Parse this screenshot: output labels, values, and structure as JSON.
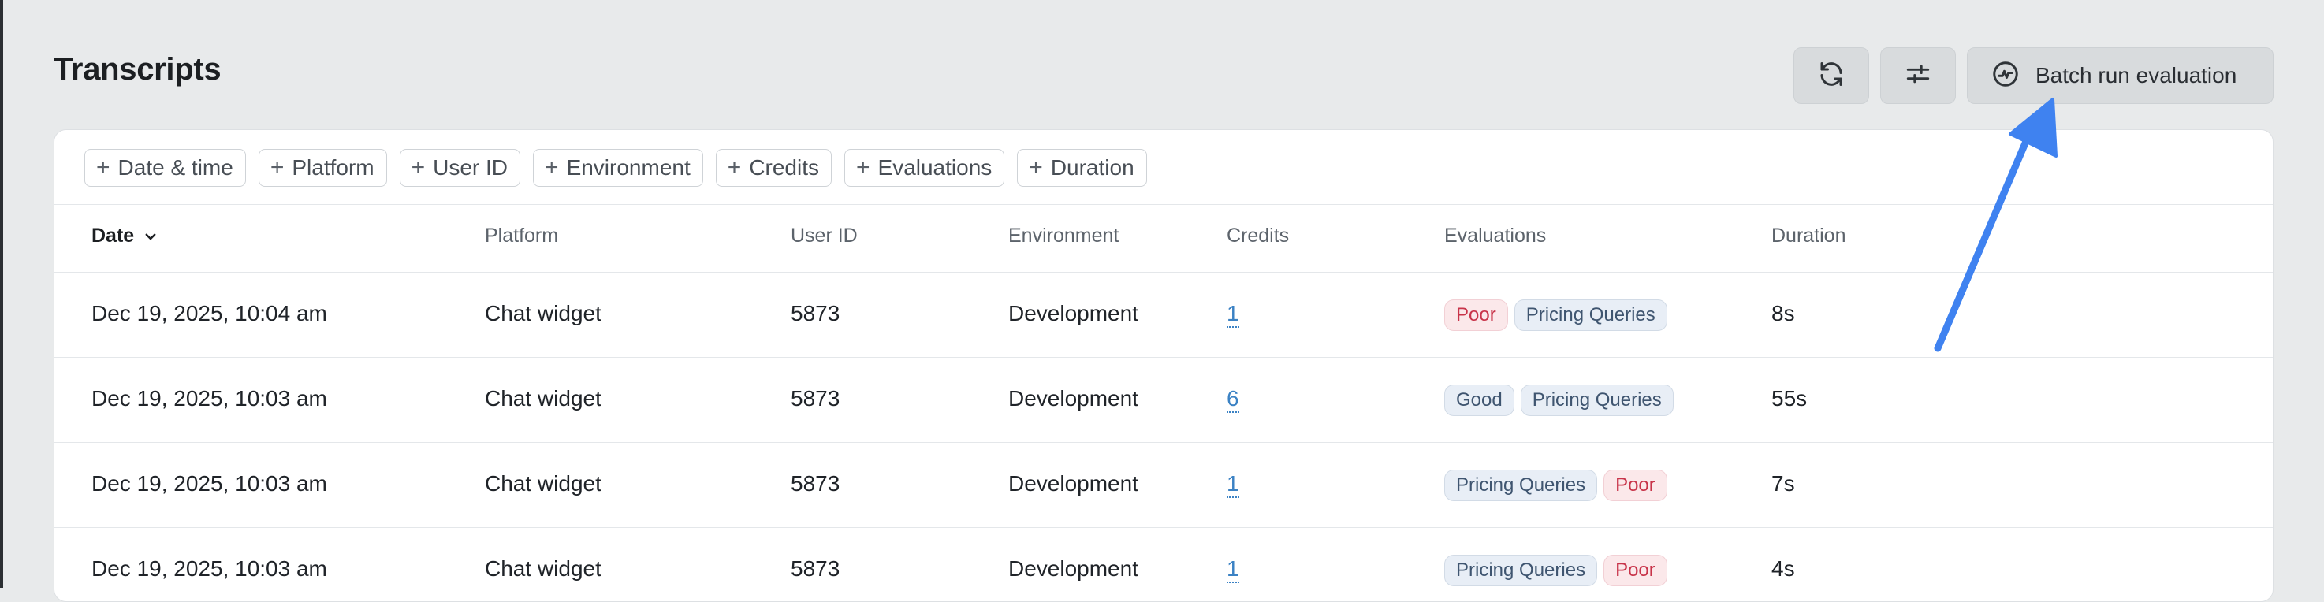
{
  "page": {
    "title": "Transcripts"
  },
  "toolbar": {
    "refresh_icon": "refresh-icon",
    "settings_icon": "sliders-icon",
    "batch_label": "Batch run evaluation",
    "batch_icon": "activity-circle-icon"
  },
  "filters": [
    {
      "label": "Date & time"
    },
    {
      "label": "Platform"
    },
    {
      "label": "User ID"
    },
    {
      "label": "Environment"
    },
    {
      "label": "Credits"
    },
    {
      "label": "Evaluations"
    },
    {
      "label": "Duration"
    }
  ],
  "table": {
    "columns": {
      "date": "Date",
      "platform": "Platform",
      "user_id": "User ID",
      "environment": "Environment",
      "credits": "Credits",
      "evaluations": "Evaluations",
      "duration": "Duration"
    },
    "rows": [
      {
        "date": "Dec 19, 2025, 10:04 am",
        "platform": "Chat widget",
        "user_id": "5873",
        "environment": "Development",
        "credits": "1",
        "evaluations": [
          {
            "label": "Poor",
            "kind": "poor"
          },
          {
            "label": "Pricing Queries",
            "kind": "neutral"
          }
        ],
        "duration": "8s"
      },
      {
        "date": "Dec 19, 2025, 10:03 am",
        "platform": "Chat widget",
        "user_id": "5873",
        "environment": "Development",
        "credits": "6",
        "evaluations": [
          {
            "label": "Good",
            "kind": "good"
          },
          {
            "label": "Pricing Queries",
            "kind": "neutral"
          }
        ],
        "duration": "55s"
      },
      {
        "date": "Dec 19, 2025, 10:03 am",
        "platform": "Chat widget",
        "user_id": "5873",
        "environment": "Development",
        "credits": "1",
        "evaluations": [
          {
            "label": "Pricing Queries",
            "kind": "neutral"
          },
          {
            "label": "Poor",
            "kind": "poor"
          }
        ],
        "duration": "7s"
      },
      {
        "date": "Dec 19, 2025, 10:03 am",
        "platform": "Chat widget",
        "user_id": "5873",
        "environment": "Development",
        "credits": "1",
        "evaluations": [
          {
            "label": "Pricing Queries",
            "kind": "neutral"
          },
          {
            "label": "Poor",
            "kind": "poor"
          }
        ],
        "duration": "4s"
      }
    ]
  },
  "colors": {
    "background": "#e8eaeb",
    "link": "#3b82c4",
    "poor": "#c8344a",
    "annotation_arrow": "#3f82f0"
  }
}
